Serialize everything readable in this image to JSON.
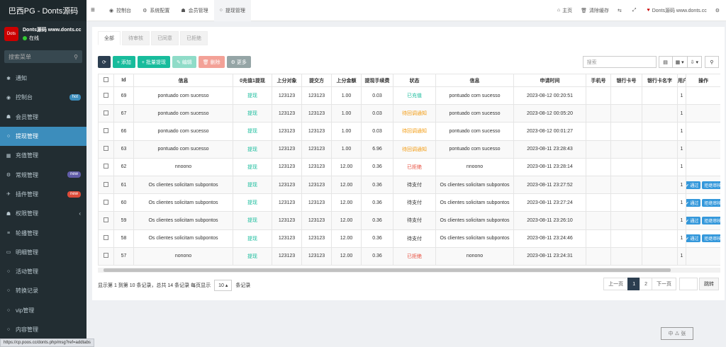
{
  "brand": "巴西PG - Donts源码",
  "user": {
    "name": "Donts源码 www.donts.cc",
    "status": "在线",
    "avatar": "Dots"
  },
  "sidebar_search": {
    "placeholder": "搜索菜单"
  },
  "sidebar": {
    "items": [
      {
        "label": "通知",
        "icon": "✱"
      },
      {
        "label": "控制台",
        "icon": "◉",
        "badge": "hot"
      },
      {
        "label": "会员管理",
        "icon": "☗"
      },
      {
        "label": "提现管理",
        "icon": "○",
        "active": true
      },
      {
        "label": "充值管理",
        "icon": "▦"
      },
      {
        "label": "常规管理",
        "icon": "⚙",
        "badge": "new"
      },
      {
        "label": "插件管理",
        "icon": "✈",
        "badge": "new"
      },
      {
        "label": "权限管理",
        "icon": "☗",
        "caret": "‹"
      },
      {
        "label": "轮播管理",
        "icon": "≡"
      },
      {
        "label": "明细管理",
        "icon": "▭"
      },
      {
        "label": "活动管理",
        "icon": "○"
      },
      {
        "label": "转换记录",
        "icon": "○"
      },
      {
        "label": "vip管理",
        "icon": "○"
      },
      {
        "label": "内容管理",
        "icon": "○"
      }
    ]
  },
  "header": {
    "toggle": "≡",
    "tabs": [
      {
        "label": "控制台",
        "icon": "◉"
      },
      {
        "label": "系统配置",
        "icon": "⚙"
      },
      {
        "label": "会员管理",
        "icon": "☗"
      },
      {
        "label": "提现管理",
        "icon": "○",
        "active": true
      }
    ],
    "right": [
      {
        "label": "主页",
        "icon": "⌂"
      },
      {
        "label": "清除缓存",
        "icon": "🗑"
      },
      {
        "label": "",
        "icon": "⇆"
      },
      {
        "label": "",
        "icon": "⤢"
      },
      {
        "label": "Donts源码 www.donts.cc",
        "icon": "♥"
      },
      {
        "label": "",
        "icon": "⚙"
      }
    ]
  },
  "sub_tabs": [
    "全部",
    "待审核",
    "已同意",
    "已拒绝"
  ],
  "toolbar": {
    "refresh": "⟳",
    "add": "+ 添加",
    "batch": "+ 批量提现",
    "edit": "✎ 编辑",
    "delete": "🗑 删除",
    "more": "⚙ 更多"
  },
  "search": {
    "placeholder": "搜索"
  },
  "table": {
    "headers": [
      "",
      "Id",
      "信息",
      "0充值1提现",
      "上分对象",
      "提交方",
      "上分金额",
      "提现手续费",
      "状态",
      "信息",
      "申请时间",
      "手机号",
      "银行卡号",
      "银行卡名字",
      "用户",
      "操作"
    ],
    "rows": [
      {
        "id": "69",
        "info": "pontuado com sucesso",
        "type": "提现",
        "target": "123123",
        "submitter": "123123",
        "amount": "1.00",
        "fee": "0.03",
        "status": "已充值",
        "status_color": "green",
        "info2": "pontuado com sucesso",
        "time": "2023-08-12 00:20:51",
        "user": "1",
        "ops": false
      },
      {
        "id": "67",
        "info": "pontuado com sucesso",
        "type": "提现",
        "target": "123123",
        "submitter": "123123",
        "amount": "1.00",
        "fee": "0.03",
        "status": "待回调通知",
        "status_color": "orange",
        "info2": "pontuado com sucesso",
        "time": "2023-08-12 00:05:20",
        "user": "1",
        "ops": false
      },
      {
        "id": "66",
        "info": "pontuado com sucesso",
        "type": "提现",
        "target": "123123",
        "submitter": "123123",
        "amount": "1.00",
        "fee": "0.03",
        "status": "待回调通知",
        "status_color": "orange",
        "info2": "pontuado com sucesso",
        "time": "2023-08-12 00:01:27",
        "user": "1",
        "ops": false
      },
      {
        "id": "63",
        "info": "pontuado com sucesso",
        "type": "提现",
        "target": "123123",
        "submitter": "123123",
        "amount": "1.00",
        "fee": "6.96",
        "status": "待回调通知",
        "status_color": "orange",
        "info2": "pontuado com sucesso",
        "time": "2023-08-11 23:28:43",
        "user": "1",
        "ops": false
      },
      {
        "id": "62",
        "info": "nnoono",
        "type": "提现",
        "target": "123123",
        "submitter": "123123",
        "amount": "12.00",
        "fee": "0.36",
        "status": "已拒绝",
        "status_color": "red",
        "info2": "nnoono",
        "time": "2023-08-11 23:28:14",
        "user": "1",
        "ops": false
      },
      {
        "id": "61",
        "info": "Os clientes solicitam subpontos",
        "type": "提现",
        "target": "123123",
        "submitter": "123123",
        "amount": "12.00",
        "fee": "0.36",
        "status": "待支付",
        "status_color": "plain",
        "info2": "Os clientes solicitam subpontos",
        "time": "2023-08-11 23:27:52",
        "user": "1",
        "ops": true
      },
      {
        "id": "60",
        "info": "Os clientes solicitam subpontos",
        "type": "提现",
        "target": "123123",
        "submitter": "123123",
        "amount": "12.00",
        "fee": "0.36",
        "status": "待支付",
        "status_color": "plain",
        "info2": "Os clientes solicitam subpontos",
        "time": "2023-08-11 23:27:24",
        "user": "1",
        "ops": true
      },
      {
        "id": "59",
        "info": "Os clientes solicitam subpontos",
        "type": "提现",
        "target": "123123",
        "submitter": "123123",
        "amount": "12.00",
        "fee": "0.36",
        "status": "待支付",
        "status_color": "plain",
        "info2": "Os clientes solicitam subpontos",
        "time": "2023-08-11 23:26:10",
        "user": "1",
        "ops": true
      },
      {
        "id": "58",
        "info": "Os clientes solicitam subpontos",
        "type": "提现",
        "target": "123123",
        "submitter": "123123",
        "amount": "12.00",
        "fee": "0.36",
        "status": "待支付",
        "status_color": "plain",
        "info2": "Os clientes solicitam subpontos",
        "time": "2023-08-11 23:24:46",
        "user": "1",
        "ops": true
      },
      {
        "id": "57",
        "info": "nonono",
        "type": "提现",
        "target": "123123",
        "submitter": "123123",
        "amount": "12.00",
        "fee": "0.36",
        "status": "已拒绝",
        "status_color": "red",
        "info2": "nonono",
        "time": "2023-08-11 23:24:31",
        "user": "1",
        "ops": false
      }
    ],
    "op_approve": "✔ 通过",
    "op_reject": "拒绝审核"
  },
  "footer": {
    "info_prefix": "显示第 1 到第 10 条记录，总共 14 条记录 每页显示",
    "page_size": "10 ▴",
    "info_suffix": "条记录"
  },
  "pagination": {
    "prev": "上一页",
    "pages": [
      "1",
      "2"
    ],
    "current": "1",
    "next": "下一页",
    "go": "跳转"
  },
  "status_url": "https://cp.poos.cc/donts.php/msg?ref=addtabs",
  "stamp": "中 ⁂ 张"
}
